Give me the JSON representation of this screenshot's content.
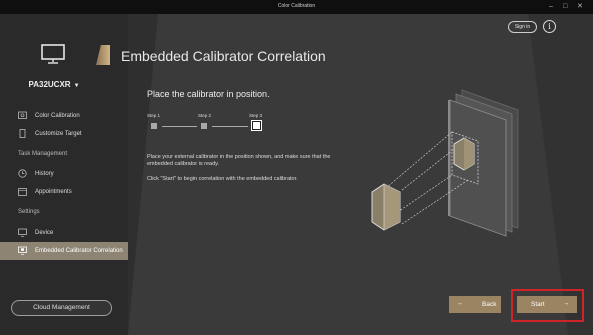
{
  "window": {
    "title": "Color Calibration",
    "controls": [
      "–",
      "□",
      "✕"
    ]
  },
  "sidebar": {
    "model": "PA32UCXR",
    "items_top": [
      {
        "label": "Color Calibration",
        "icon": "calibration-icon"
      },
      {
        "label": "Customize Target",
        "icon": "target-icon"
      }
    ],
    "section_task": "Task Management",
    "items_task": [
      {
        "label": "History",
        "icon": "history-icon"
      },
      {
        "label": "Appointments",
        "icon": "calendar-icon"
      }
    ],
    "section_settings": "Settings",
    "items_settings": [
      {
        "label": "Device",
        "icon": "monitor-icon"
      },
      {
        "label": "Embedded Calibrator Correlation",
        "icon": "calibrator-icon",
        "active": true
      }
    ],
    "cloud_button": "Cloud Management"
  },
  "header": {
    "title": "Embedded Calibrator Correlation",
    "signin": "Sign in",
    "info": "i"
  },
  "content": {
    "instruction": "Place the calibrator in position.",
    "steps": [
      {
        "label": "Step 1"
      },
      {
        "label": "Step 2"
      },
      {
        "label": "Step 3",
        "current": true
      }
    ],
    "desc1": "Place your external calibrator in the position shown, and make sure that the embedded calibrator is ready.",
    "desc2": "Click \"Start\" to begin correlation with the embedded calibrator."
  },
  "footer": {
    "back": "Back",
    "start": "Start",
    "back_arrow": "←",
    "start_arrow": "→"
  },
  "colors": {
    "accent": "#9b8461",
    "active_nav": "#8d8474",
    "highlight": "#d2232a"
  }
}
